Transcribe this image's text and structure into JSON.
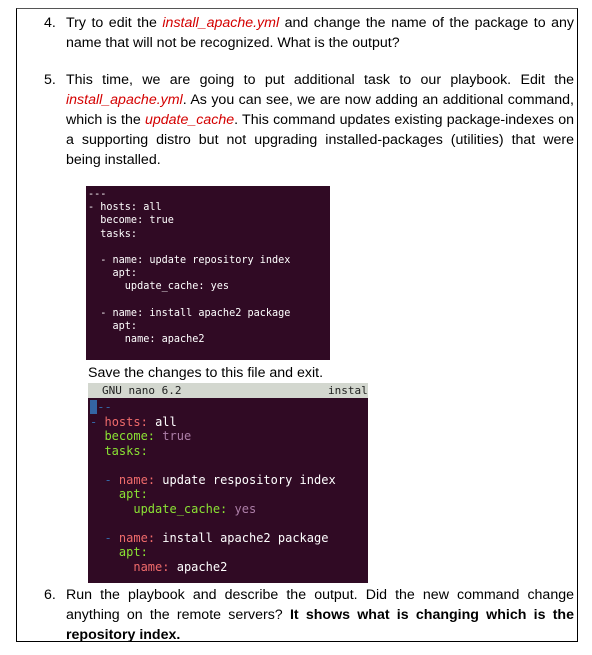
{
  "items": [
    {
      "number": "4.",
      "pre": "Try to edit the ",
      "file": "install_apache.yml",
      "post": " and change the name of the package to any name that will not be recognized. What is the output?"
    },
    {
      "number": "5.",
      "pre": "This time, we are going to put additional task to our playbook. Edit the ",
      "file": "install_apache.yml",
      "mid": ". As you can see, we are now adding an additional command, which is the ",
      "cmd": "update_cache",
      "post": ". This command updates existing package-indexes on a supporting distro but not upgrading installed-packages (utilities) that were being installed."
    },
    {
      "number": "6.",
      "pre": "Run the playbook and describe the output. Did the new command change anything on the remote servers? ",
      "answer": "It shows what is changing which is the repository index."
    }
  ],
  "code_block": {
    "lines": [
      "---",
      "- hosts: all",
      "  become: true",
      "  tasks:",
      "",
      "  - name: update repository index",
      "    apt:",
      "      update_cache: yes",
      "",
      "  - name: install apache2 package",
      "    apt:",
      "      name: apache2"
    ]
  },
  "save_text": "Save the changes to this file and exit.",
  "nano": {
    "title": "GNU nano 6.2",
    "file": "instal",
    "dashes": "--",
    "hosts_key": "hosts:",
    "hosts_val": "all",
    "become_key": "become:",
    "become_val": "true",
    "tasks_key": "tasks:",
    "task1_name_key": "name:",
    "task1_name_val": "update respository index",
    "task1_apt": "apt:",
    "task1_cache_key": "update_cache:",
    "task1_cache_val": "yes",
    "task2_name_key": "name:",
    "task2_name_val": "install apache2 package",
    "task2_apt": "apt:",
    "task2_pkg_key": "name:",
    "task2_pkg_val": "apache2"
  },
  "colors": {
    "terminal_bg": "#300a24",
    "filename_red": "#d40000",
    "nano_bar": "#d3d7cf",
    "yaml_key": "#ef6b6b",
    "yaml_key_green": "#8ae234",
    "yaml_value_purple": "#ad7fa8"
  }
}
